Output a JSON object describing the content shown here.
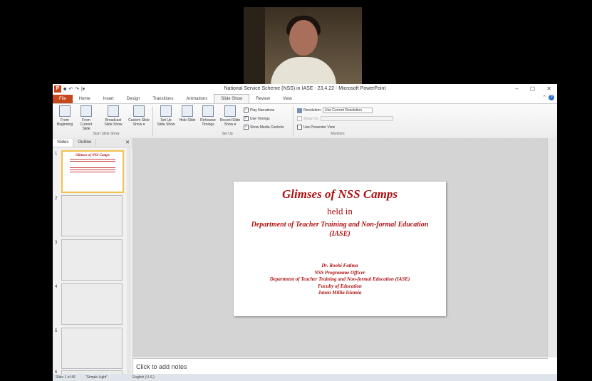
{
  "window": {
    "title": "National Service Scheme (NSS) in IASE - 23.4.22  -  Microsoft PowerPoint",
    "controls": [
      "–",
      "▢",
      "✕"
    ]
  },
  "quick_access": {
    "logo": "P",
    "save": "■",
    "undo": "↶",
    "redo": "↷",
    "more": "|▾"
  },
  "tabs": [
    "File",
    "Home",
    "Insert",
    "Design",
    "Transitions",
    "Animations",
    "Slide Show",
    "Review",
    "View"
  ],
  "active_tab": "Slide Show",
  "ribbon": {
    "buttons": [
      {
        "label": "From Beginning"
      },
      {
        "label": "From Current Slide"
      },
      {
        "label": "Broadcast Slide Show"
      },
      {
        "label": "Custom Slide Show ▾"
      },
      {
        "label": "Set Up Slide Show"
      },
      {
        "label": "Hide Slide"
      },
      {
        "label": "Rehearse Timings"
      },
      {
        "label": "Record Slide Show ▾"
      }
    ],
    "groups": [
      "Start Slide Show",
      "Set Up",
      "Monitors"
    ],
    "checks": [
      {
        "label": "Play Narrations",
        "checked": true
      },
      {
        "label": "Use Timings",
        "checked": true
      },
      {
        "label": "Show Media Controls",
        "checked": true
      },
      {
        "label": "Use Presenter View",
        "checked": false
      }
    ],
    "resolution_label": "Resolution:",
    "resolution_value": "Use Current Resolution",
    "show_on_label": "Show On:"
  },
  "panel": {
    "tabs": [
      "Slides",
      "Outline"
    ],
    "close": "✕",
    "slide_numbers": [
      "1",
      "2",
      "3",
      "4",
      "5",
      "6"
    ]
  },
  "thumb1": {
    "title": "Glimses of NSS Camps"
  },
  "slide": {
    "title": "Glimses of NSS Camps",
    "held_in": "held in",
    "dept": "Department of Teacher Training and Non-formal Education",
    "iase": "(IASE)",
    "author": "Dr. Roohi Fatima",
    "role": "NSS Programme Officer",
    "dept2": "Department of Teacher Training and Non-formal Education (IASE)",
    "faculty": "Faculty of Education",
    "university": "Jamia Millia Islamia"
  },
  "notes_placeholder": "Click to add notes",
  "status": {
    "slide_count": "Slide 1 of 46",
    "theme": "\"Simple Light\"",
    "language": "English (U.S.)"
  },
  "colors": {
    "accent": "#c8461e",
    "slide_text": "#b01010",
    "thumb_selected": "#f2c24a"
  }
}
